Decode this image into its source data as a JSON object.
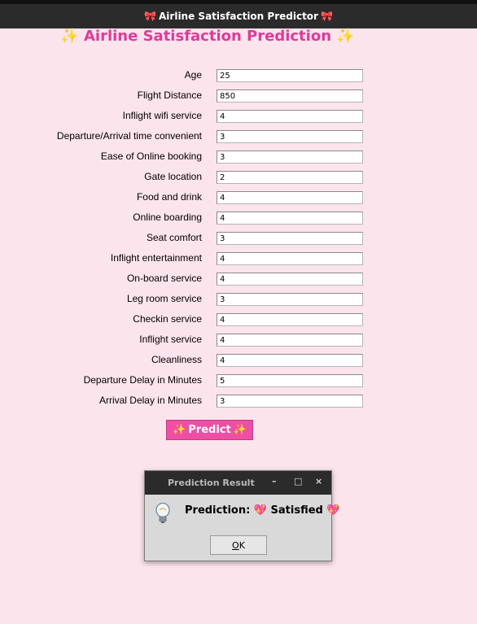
{
  "window": {
    "title": "Airline Satisfaction Predictor",
    "bow_icon": "🎀"
  },
  "heading": {
    "text": "Airline Satisfaction Prediction",
    "sparkle": "✨"
  },
  "fields": [
    {
      "label": "Age",
      "value": "25"
    },
    {
      "label": "Flight Distance",
      "value": "850"
    },
    {
      "label": "Inflight wifi service",
      "value": "4"
    },
    {
      "label": "Departure/Arrival time convenient",
      "value": "3"
    },
    {
      "label": "Ease of Online booking",
      "value": "3"
    },
    {
      "label": "Gate location",
      "value": "2"
    },
    {
      "label": "Food and drink",
      "value": "4"
    },
    {
      "label": "Online boarding",
      "value": "4"
    },
    {
      "label": "Seat comfort",
      "value": "3"
    },
    {
      "label": "Inflight entertainment",
      "value": "4"
    },
    {
      "label": "On-board service",
      "value": "4"
    },
    {
      "label": "Leg room service",
      "value": "3"
    },
    {
      "label": "Checkin service",
      "value": "4"
    },
    {
      "label": "Inflight service",
      "value": "4"
    },
    {
      "label": "Cleanliness",
      "value": "4"
    },
    {
      "label": "Departure Delay in Minutes",
      "value": "5"
    },
    {
      "label": "Arrival Delay in Minutes",
      "value": "3"
    }
  ],
  "predict_button": {
    "label": "Predict",
    "sparkle": "✨"
  },
  "dialog": {
    "title": "Prediction Result",
    "minimize": "–",
    "maximize": "□",
    "close": "×",
    "prefix": "Prediction:",
    "heart": "💖",
    "result": "Satisfied",
    "ok_underlined": "O",
    "ok_rest": "K"
  },
  "colors": {
    "background": "#fce4ec",
    "heading": "#e0399a",
    "button": "#ee4fa4",
    "titlebar": "#2b2b2b"
  }
}
